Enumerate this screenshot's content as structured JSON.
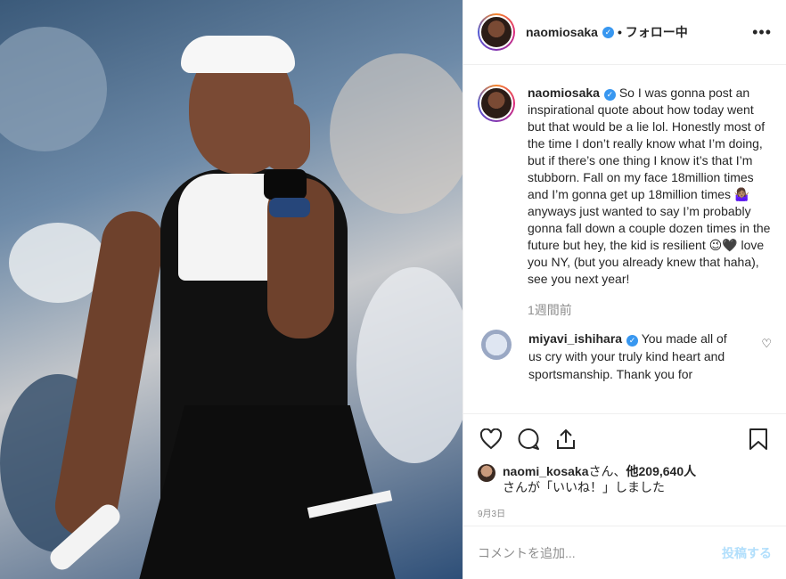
{
  "header": {
    "username": "naomiosaka",
    "follow_status": "• フォロー中",
    "more_icon": "more-icon"
  },
  "caption": {
    "username": "naomiosaka",
    "text": "So I was gonna post an inspirational quote about how today went but that would be a lie lol. Honestly most of the time I don’t really know what I’m doing, but if there’s one thing I know it’s that I’m stubborn. Fall on my face 18million times and I’m gonna get up 18million times 🤷🏽‍♀️ anyways just wanted to say I’m probably gonna fall down a couple dozen times in the future but hey, the kid is resilient 😉🖤 love you NY, (but you already knew that haha), see you next year!",
    "time": "1週間前"
  },
  "comments": [
    {
      "username": "miyavi_ishihara",
      "text": "You made all of us cry with your truly kind heart and sportsmanship. Thank you for"
    }
  ],
  "likes": {
    "liker": "naomi_kosaka",
    "suffix": "さん、",
    "others": "他209,640人",
    "line2": "さんが「いいね！」しました"
  },
  "date": "9月3日",
  "composer": {
    "placeholder": "コメントを追加...",
    "post_label": "投稿する"
  },
  "colors": {
    "verified": "#3897f0",
    "post_button_disabled": "#b2dffc",
    "muted_text": "#8e8e8e"
  }
}
